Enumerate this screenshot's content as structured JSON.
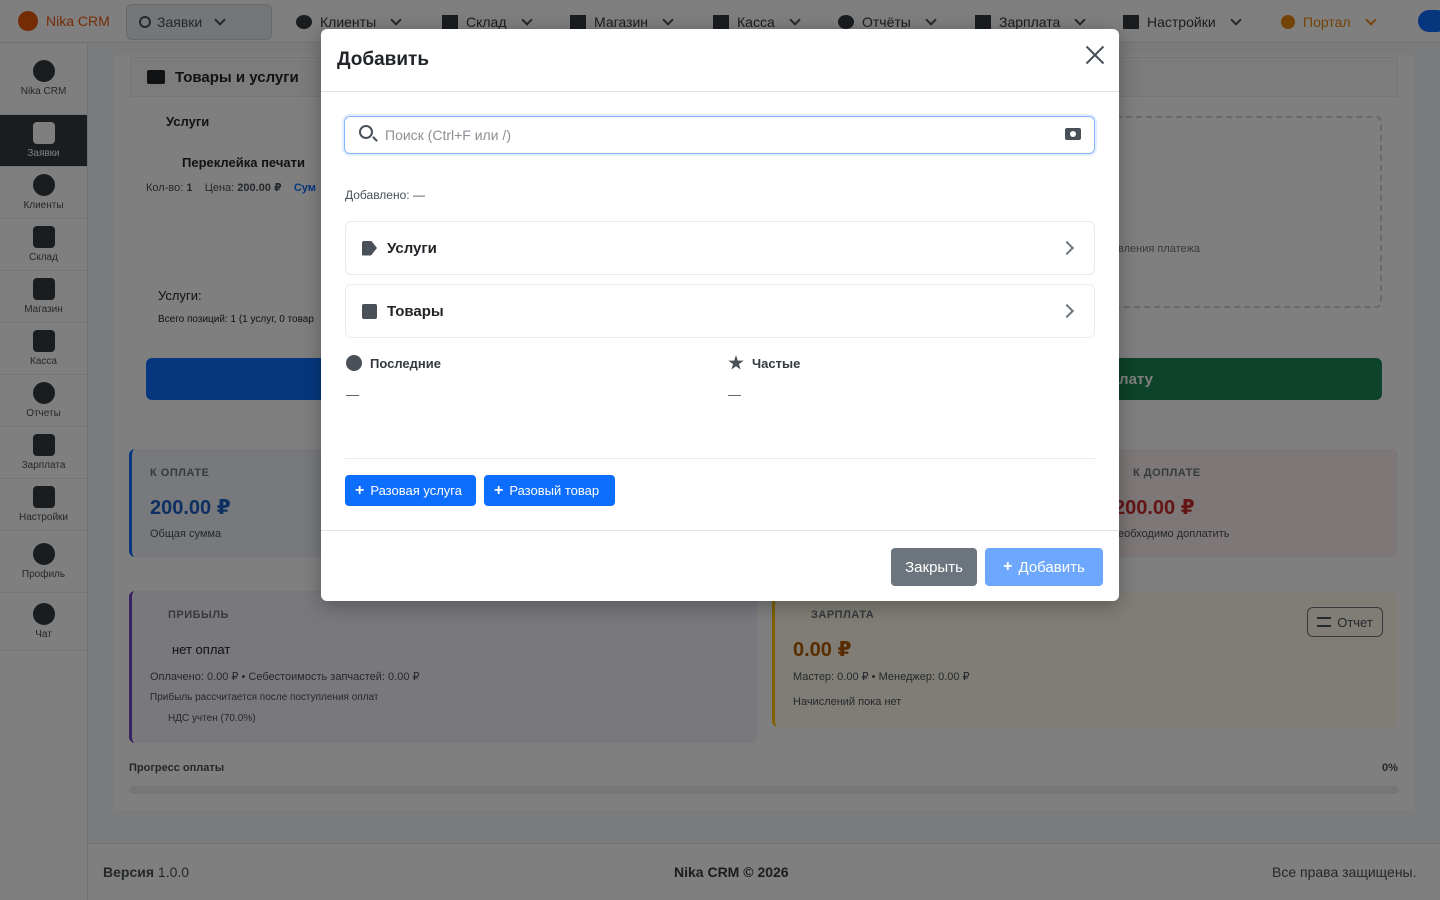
{
  "nav": {
    "brand": "Nika CRM",
    "search_item": "Заявки",
    "items": [
      "Клиенты",
      "Склад",
      "Магазин",
      "Касса",
      "Отчёты",
      "Зарплата",
      "Настройки"
    ],
    "portal": "Портал"
  },
  "sidebar": {
    "items": [
      {
        "label": "Nika CRM"
      },
      {
        "label": "Заявки"
      },
      {
        "label": "Клиенты"
      },
      {
        "label": "Склад"
      },
      {
        "label": "Магазин"
      },
      {
        "label": "Касса"
      },
      {
        "label": "Отчеты"
      },
      {
        "label": "Зарплата"
      },
      {
        "label": "Настройки"
      },
      {
        "label": "Профиль"
      },
      {
        "label": "Чат"
      }
    ]
  },
  "background": {
    "panel_title": "Товары и услуги",
    "services_label": "Услуги",
    "service_name": "Переклейка печати",
    "service_qty_label": "Кол-во:",
    "service_qty": "1",
    "service_price_label": "Цена:",
    "service_price": "200.00 ₽",
    "service_sum_label": "Сум",
    "summary_label": "Услуги:",
    "summary_positions": "Всего позиций: 1 (1 услуг, 0 товар",
    "payment_hint": "вления платежа",
    "pay_button": "плату",
    "to_pay_label": "К ОПЛАТЕ",
    "to_pay_value": "200.00 ₽",
    "to_pay_sub": "Общая сумма",
    "surcharge_label": "К ДОПЛАТЕ",
    "surcharge_value": "200.00 ₽",
    "surcharge_sub": "еобходимо доплатить",
    "profit_label": "ПРИБЫЛЬ",
    "profit_status": "нет оплат",
    "profit_paid_line": "Оплачено: 0.00 ₽ • Себестоимость запчастей: 0.00 ₽",
    "profit_note": "Прибыль рассчитается после поступления оплат",
    "vat_note": "НДС учтен (70.0%)",
    "salary_label": "ЗАРПЛАТА",
    "salary_value": "0.00 ₽",
    "salary_line": "Мастер: 0.00 ₽ • Менеджер: 0.00 ₽",
    "salary_note": "Начислений пока нет",
    "report_button": "Отчет",
    "progress_label": "Прогресс оплаты",
    "progress_pct": "0%"
  },
  "footer": {
    "version_label": "Версия",
    "version": "1.0.0",
    "copyright": "Nika CRM © 2026",
    "rights": "Все права защищены."
  },
  "modal": {
    "title": "Добавить",
    "search_placeholder": "Поиск (Ctrl+F или /)",
    "added_label": "Добавлено: —",
    "categories": [
      {
        "label": "Услуги",
        "icon": "tag-icon"
      },
      {
        "label": "Товары",
        "icon": "box-icon"
      }
    ],
    "recent_label": "Последние",
    "recent_value": "—",
    "frequent_label": "Частые",
    "frequent_value": "—",
    "one_service_button": "Разовая услуга",
    "one_product_button": "Разовый товар",
    "close_button": "Закрыть",
    "add_button": "Добавить"
  }
}
